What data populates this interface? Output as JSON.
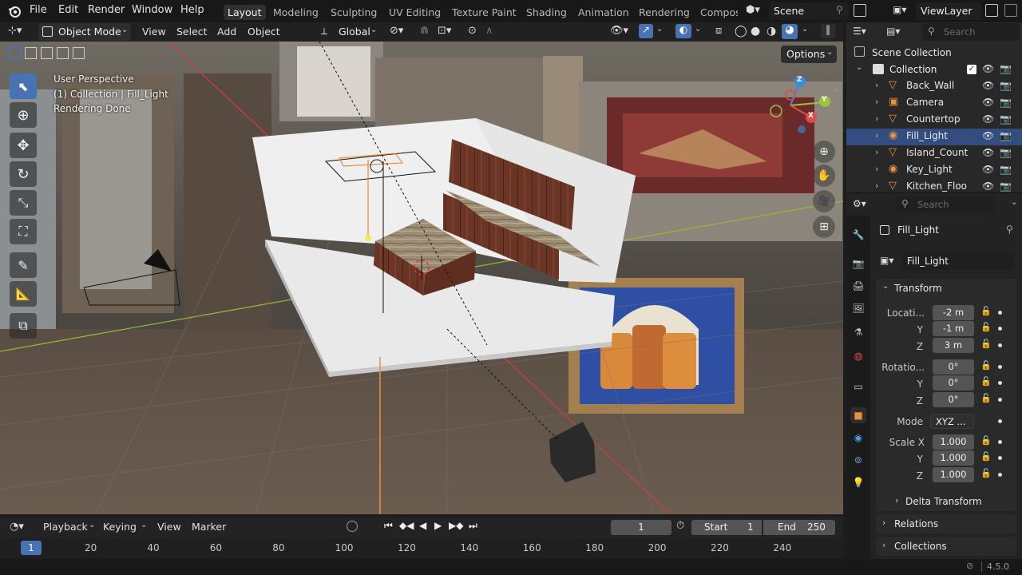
{
  "menus": [
    "File",
    "Edit",
    "Render",
    "Window",
    "Help"
  ],
  "workspaces": [
    {
      "label": "Layout",
      "active": true
    },
    {
      "label": "Modeling"
    },
    {
      "label": "Sculpting"
    },
    {
      "label": "UV Editing"
    },
    {
      "label": "Texture Paint"
    },
    {
      "label": "Shading"
    },
    {
      "label": "Animation"
    },
    {
      "label": "Rendering"
    },
    {
      "label": "Compos"
    }
  ],
  "scene": "Scene",
  "view_layer": "ViewLayer",
  "viewport_header": {
    "mode": "Object Mode",
    "menus": [
      "View",
      "Select",
      "Add",
      "Object"
    ],
    "orientation": "Global",
    "options": "Options"
  },
  "overlay": {
    "line1": "User Perspective",
    "line2": "(1) Collection | Fill_Light",
    "line3": "Rendering Done"
  },
  "axes": {
    "x": "X",
    "y": "Y",
    "z": "Z"
  },
  "outliner": {
    "search_placeholder": "Search",
    "root": "Scene Collection",
    "collection": "Collection",
    "items": [
      {
        "name": "Back_Wall",
        "type": "mesh",
        "selected": false
      },
      {
        "name": "Camera",
        "type": "camera",
        "selected": false
      },
      {
        "name": "Countertop",
        "type": "mesh",
        "selected": false
      },
      {
        "name": "Fill_Light",
        "type": "light",
        "selected": true
      },
      {
        "name": "Island_Count",
        "type": "mesh",
        "selected": false
      },
      {
        "name": "Key_Light",
        "type": "light",
        "selected": false
      },
      {
        "name": "Kitchen_Floo",
        "type": "mesh",
        "selected": false
      }
    ]
  },
  "properties": {
    "search_placeholder": "Search",
    "object_name": "Fill_Light",
    "data_name": "Fill_Light",
    "transform_label": "Transform",
    "location_label": "Locati...",
    "rotation_label": "Rotatio...",
    "mode_label": "Mode",
    "scale_label": "Scale X",
    "y_label": "Y",
    "z_label": "Z",
    "location": [
      "-2 m",
      "-1 m",
      "3 m"
    ],
    "rotation": [
      "0°",
      "0°",
      "0°"
    ],
    "mode": "XYZ ...",
    "scale": [
      "1.000",
      "1.000",
      "1.000"
    ],
    "delta_transform": "Delta Transform",
    "relations": "Relations",
    "collections": "Collections"
  },
  "timeline": {
    "menus": [
      "Playback",
      "Keying",
      "View",
      "Marker"
    ],
    "current_frame": "1",
    "start_label": "Start",
    "start": "1",
    "end_label": "End",
    "end": "250",
    "ruler": [
      "20",
      "40",
      "60",
      "80",
      "100",
      "120",
      "140",
      "160",
      "180",
      "200",
      "220",
      "240"
    ],
    "playhead": "1"
  },
  "status": {
    "version": "4.5.0"
  },
  "colors": {
    "accent": "#4772b3",
    "selection_row": "#334d80",
    "light_orange": "#e8923c",
    "axis_x": "#e04a4a",
    "axis_y": "#9ac33c",
    "axis_z": "#3b8be0"
  }
}
